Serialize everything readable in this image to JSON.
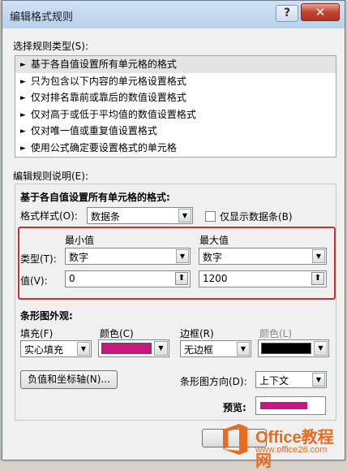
{
  "window": {
    "title": "编辑格式规则",
    "help_label": "?",
    "close_label": "✕"
  },
  "rule_type": {
    "heading": "选择规则类型(S):",
    "items": [
      "基于各自值设置所有单元格的格式",
      "只为包含以下内容的单元格设置格式",
      "仅对排名靠前或靠后的数值设置格式",
      "仅对高于或低于平均值的数值设置格式",
      "仅对唯一值或重复值设置格式",
      "使用公式确定要设置格式的单元格"
    ],
    "selected_index": 0,
    "item_marker": "►"
  },
  "rule_edit": {
    "heading": "编辑规则说明(E):",
    "subheading": "基于各自值设置所有单元格的格式:",
    "format_style_label": "格式样式(O):",
    "format_style_value": "数据条",
    "show_bar_only_label": "仅显示数据条(B)",
    "show_bar_only_checked": false,
    "min_header": "最小值",
    "max_header": "最大值",
    "type_label": "类型(T):",
    "value_label": "值(V):",
    "min_type": "数字",
    "max_type": "数字",
    "min_value": "0",
    "max_value": "1200"
  },
  "appearance": {
    "heading": "条形图外观:",
    "fill_label": "填充(F)",
    "fill_value": "实心填充",
    "color_label": "颜色(C)",
    "fill_color": "#c9157f",
    "border_label": "边框(R)",
    "border_value": "无边框",
    "border_color_label": "颜色(L)",
    "border_color": "#000000",
    "neg_axis_button": "负值和坐标轴(N)...",
    "direction_label": "条形图方向(D):",
    "direction_value": "上下文",
    "preview_label": "预览:",
    "preview_color": "#c9157f"
  },
  "watermark": {
    "title": "Office教程网",
    "url": "www.office26.com"
  },
  "icons": {
    "dropdown": "▼",
    "range_picker": "⬆"
  }
}
